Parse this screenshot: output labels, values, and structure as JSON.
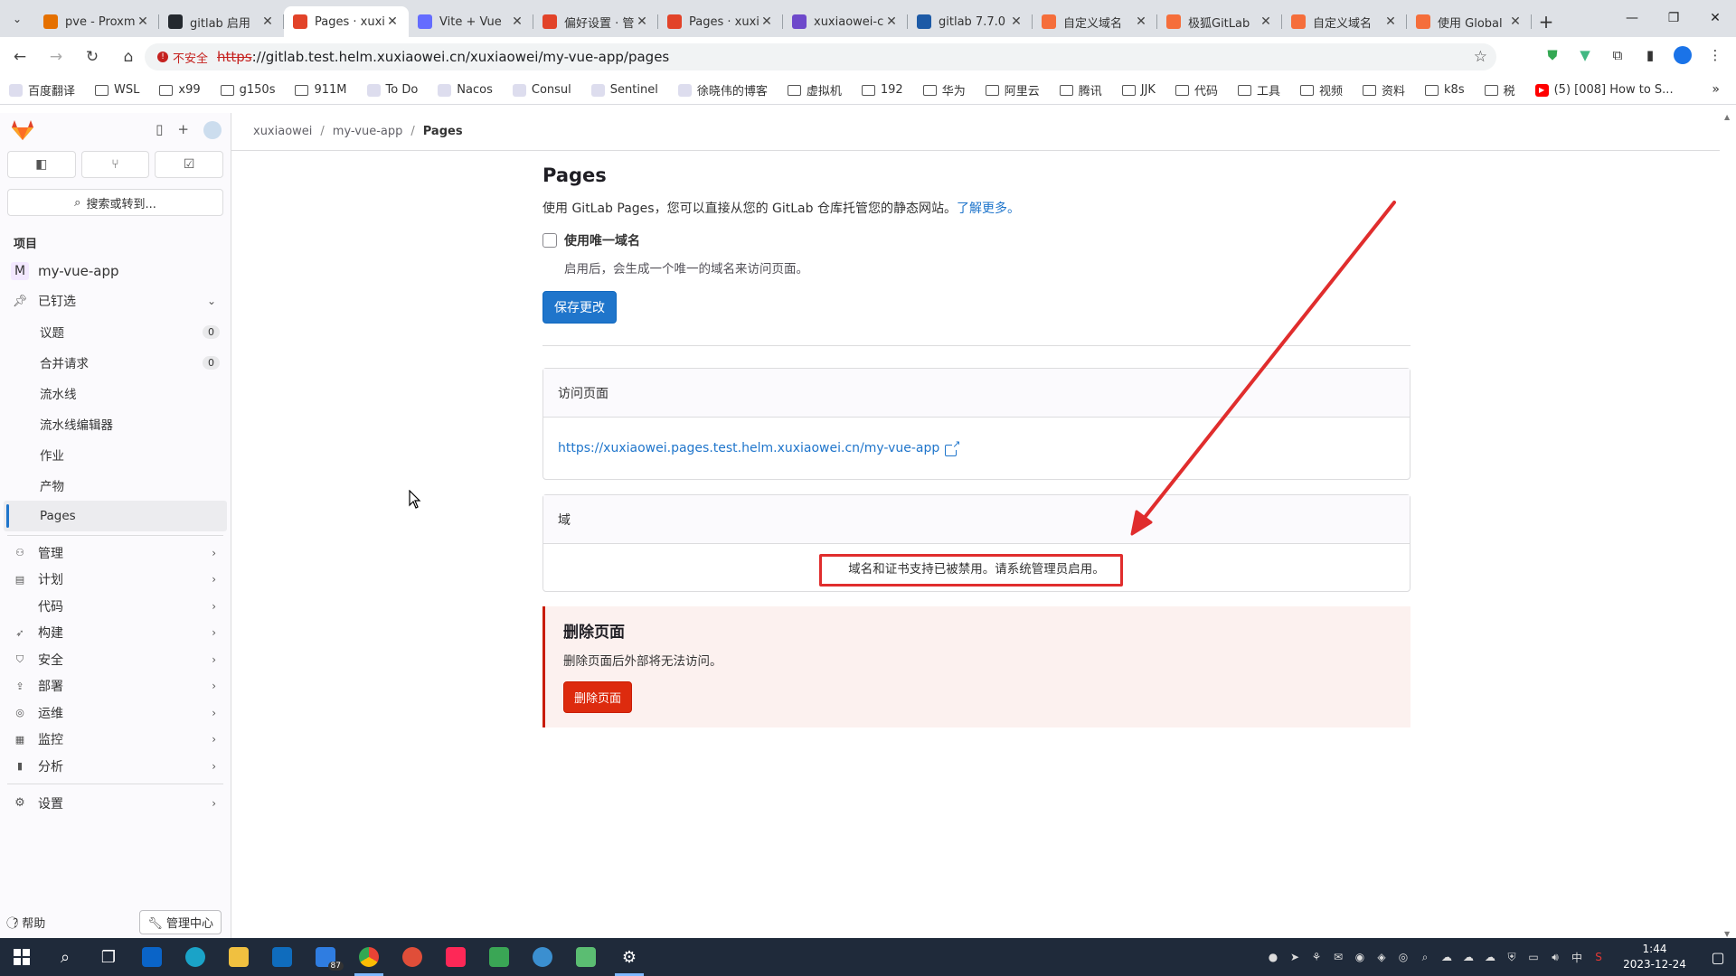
{
  "browser": {
    "tabs": [
      {
        "title": "pve - Proxm",
        "color": "#e57000",
        "active": false
      },
      {
        "title": "gitlab 启用 ",
        "color": "#24292f",
        "active": false
      },
      {
        "title": "Pages · xuxi",
        "color": "#e24329",
        "active": true
      },
      {
        "title": "Vite + Vue",
        "color": "#646cff",
        "active": false
      },
      {
        "title": "偏好设置 · 管",
        "color": "#e24329",
        "active": false
      },
      {
        "title": "Pages · xuxi",
        "color": "#e24329",
        "active": false
      },
      {
        "title": "xuxiaowei-c",
        "color": "#6e49cb",
        "active": false
      },
      {
        "title": "gitlab 7.7.0",
        "color": "#1d5aa6",
        "active": false
      },
      {
        "title": "自定义域名",
        "color": "#f56e3b",
        "active": false
      },
      {
        "title": "极狐GitLab",
        "color": "#f56e3b",
        "active": false
      },
      {
        "title": "自定义域名",
        "color": "#f56e3b",
        "active": false
      },
      {
        "title": "使用 Global",
        "color": "#f56e3b",
        "active": false
      }
    ],
    "address": {
      "security_label": "不安全",
      "scheme": "https",
      "url_rest": "://gitlab.test.helm.xuxiaowei.cn/xuxiaowei/my-vue-app/pages"
    },
    "bookmarks": [
      {
        "label": "百度翻译",
        "type": "icon"
      },
      {
        "label": "WSL",
        "type": "folder"
      },
      {
        "label": "x99",
        "type": "folder"
      },
      {
        "label": "g150s",
        "type": "folder"
      },
      {
        "label": "911M",
        "type": "folder"
      },
      {
        "label": "To Do",
        "type": "icon"
      },
      {
        "label": "Nacos",
        "type": "icon"
      },
      {
        "label": "Consul",
        "type": "icon"
      },
      {
        "label": "Sentinel",
        "type": "icon"
      },
      {
        "label": "徐晓伟的博客",
        "type": "icon"
      },
      {
        "label": "虚拟机",
        "type": "folder"
      },
      {
        "label": "192",
        "type": "folder"
      },
      {
        "label": "华为",
        "type": "folder"
      },
      {
        "label": "阿里云",
        "type": "folder"
      },
      {
        "label": "腾讯",
        "type": "folder"
      },
      {
        "label": "JJK",
        "type": "folder"
      },
      {
        "label": "代码",
        "type": "folder"
      },
      {
        "label": "工具",
        "type": "folder"
      },
      {
        "label": "视频",
        "type": "folder"
      },
      {
        "label": "资料",
        "type": "folder"
      },
      {
        "label": "k8s",
        "type": "folder"
      },
      {
        "label": "税",
        "type": "folder"
      },
      {
        "label": "(5) [008] How to S...",
        "type": "youtube"
      }
    ]
  },
  "sidebar": {
    "search_label": "搜索或转到...",
    "section_title": "项目",
    "project_initial": "M",
    "project_name": "my-vue-app",
    "pinned_label": "已钉选",
    "pinned_items": [
      {
        "label": "议题",
        "badge": "0"
      },
      {
        "label": "合并请求",
        "badge": "0"
      },
      {
        "label": "流水线",
        "badge": ""
      },
      {
        "label": "流水线编辑器",
        "badge": ""
      },
      {
        "label": "作业",
        "badge": ""
      },
      {
        "label": "产物",
        "badge": ""
      },
      {
        "label": "Pages",
        "badge": "",
        "active": true
      }
    ],
    "groups": [
      {
        "label": "管理",
        "icon": "users-icon"
      },
      {
        "label": "计划",
        "icon": "calendar-icon"
      },
      {
        "label": "代码",
        "icon": "code-icon"
      },
      {
        "label": "构建",
        "icon": "rocket-icon"
      },
      {
        "label": "安全",
        "icon": "shield-icon"
      },
      {
        "label": "部署",
        "icon": "deploy-icon"
      },
      {
        "label": "运维",
        "icon": "monitor-icon"
      },
      {
        "label": "监控",
        "icon": "chart-icon"
      },
      {
        "label": "分析",
        "icon": "analytics-icon"
      }
    ],
    "settings_label": "设置",
    "help_label": "帮助",
    "admin_label": "管理中心"
  },
  "breadcrumb": {
    "items": [
      "xuxiaowei",
      "my-vue-app"
    ],
    "current": "Pages"
  },
  "main": {
    "title": "Pages",
    "description": "使用 GitLab Pages，您可以直接从您的 GitLab 仓库托管您的静态网站。",
    "learn_more": "了解更多。",
    "unique_domain_label": "使用唯一域名",
    "unique_domain_help": "启用后，会生成一个唯一的域名来访问页面。",
    "save_button": "保存更改",
    "access_card": {
      "title": "访问页面",
      "url": "https://xuxiaowei.pages.test.helm.xuxiaowei.cn/my-vue-app"
    },
    "domain_card": {
      "title": "域",
      "message": "域名和证书支持已被禁用。请系统管理员启用。"
    },
    "danger": {
      "title": "删除页面",
      "text": "删除页面后外部将无法访问。",
      "button": "删除页面"
    }
  },
  "taskbar": {
    "badge_87": "87",
    "time": "1:44",
    "date": "2023-12-24",
    "ime": "中"
  },
  "colors": {
    "accent": "#1f75cb",
    "danger": "#dd2b0e",
    "annotation": "#e02d2d"
  }
}
